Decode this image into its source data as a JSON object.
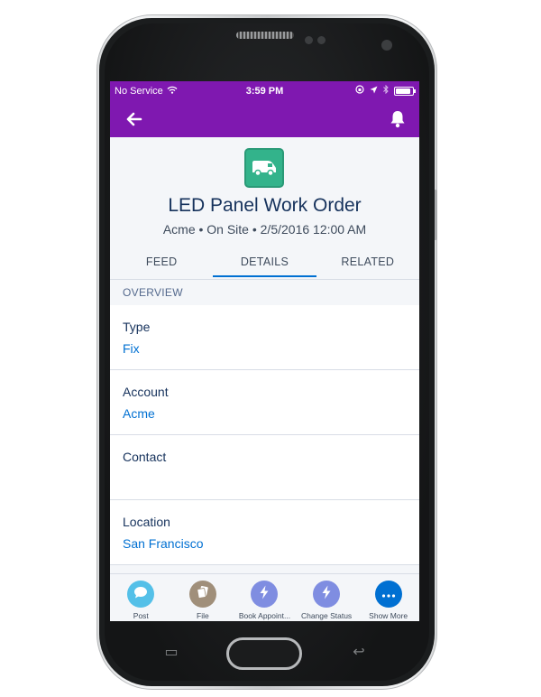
{
  "status_bar": {
    "carrier": "No Service",
    "time": "3:59 PM",
    "battery_level": 0.9
  },
  "colors": {
    "brand_purple": "#7f18b0",
    "accent_blue": "#0070d2",
    "record_icon_green": "#33b38b",
    "post_action": "#54c0e8",
    "file_action": "#a08f7a",
    "book_action": "#7f8de1",
    "status_action": "#7f8de1",
    "more_action": "#0070d2"
  },
  "header": {
    "back_icon": "back-arrow-icon",
    "bell_icon": "bell-icon"
  },
  "record": {
    "icon": "van-icon",
    "title": "LED Panel Work Order",
    "subtitle": "Acme • On Site • 2/5/2016 12:00 AM"
  },
  "tabs": [
    {
      "label": "FEED",
      "active": false
    },
    {
      "label": "DETAILS",
      "active": true
    },
    {
      "label": "RELATED",
      "active": false
    }
  ],
  "section": {
    "title": "OVERVIEW"
  },
  "fields": [
    {
      "label": "Type",
      "value": "Fix"
    },
    {
      "label": "Account",
      "value": "Acme"
    },
    {
      "label": "Contact",
      "value": ""
    },
    {
      "label": "Location",
      "value": "San Francisco"
    }
  ],
  "actions": [
    {
      "label": "Post",
      "icon": "chat-bubble-icon"
    },
    {
      "label": "File",
      "icon": "file-icon"
    },
    {
      "label": "Book Appoint...",
      "icon": "lightning-icon"
    },
    {
      "label": "Change Status",
      "icon": "lightning-icon"
    },
    {
      "label": "Show More",
      "icon": "more-icon"
    }
  ]
}
